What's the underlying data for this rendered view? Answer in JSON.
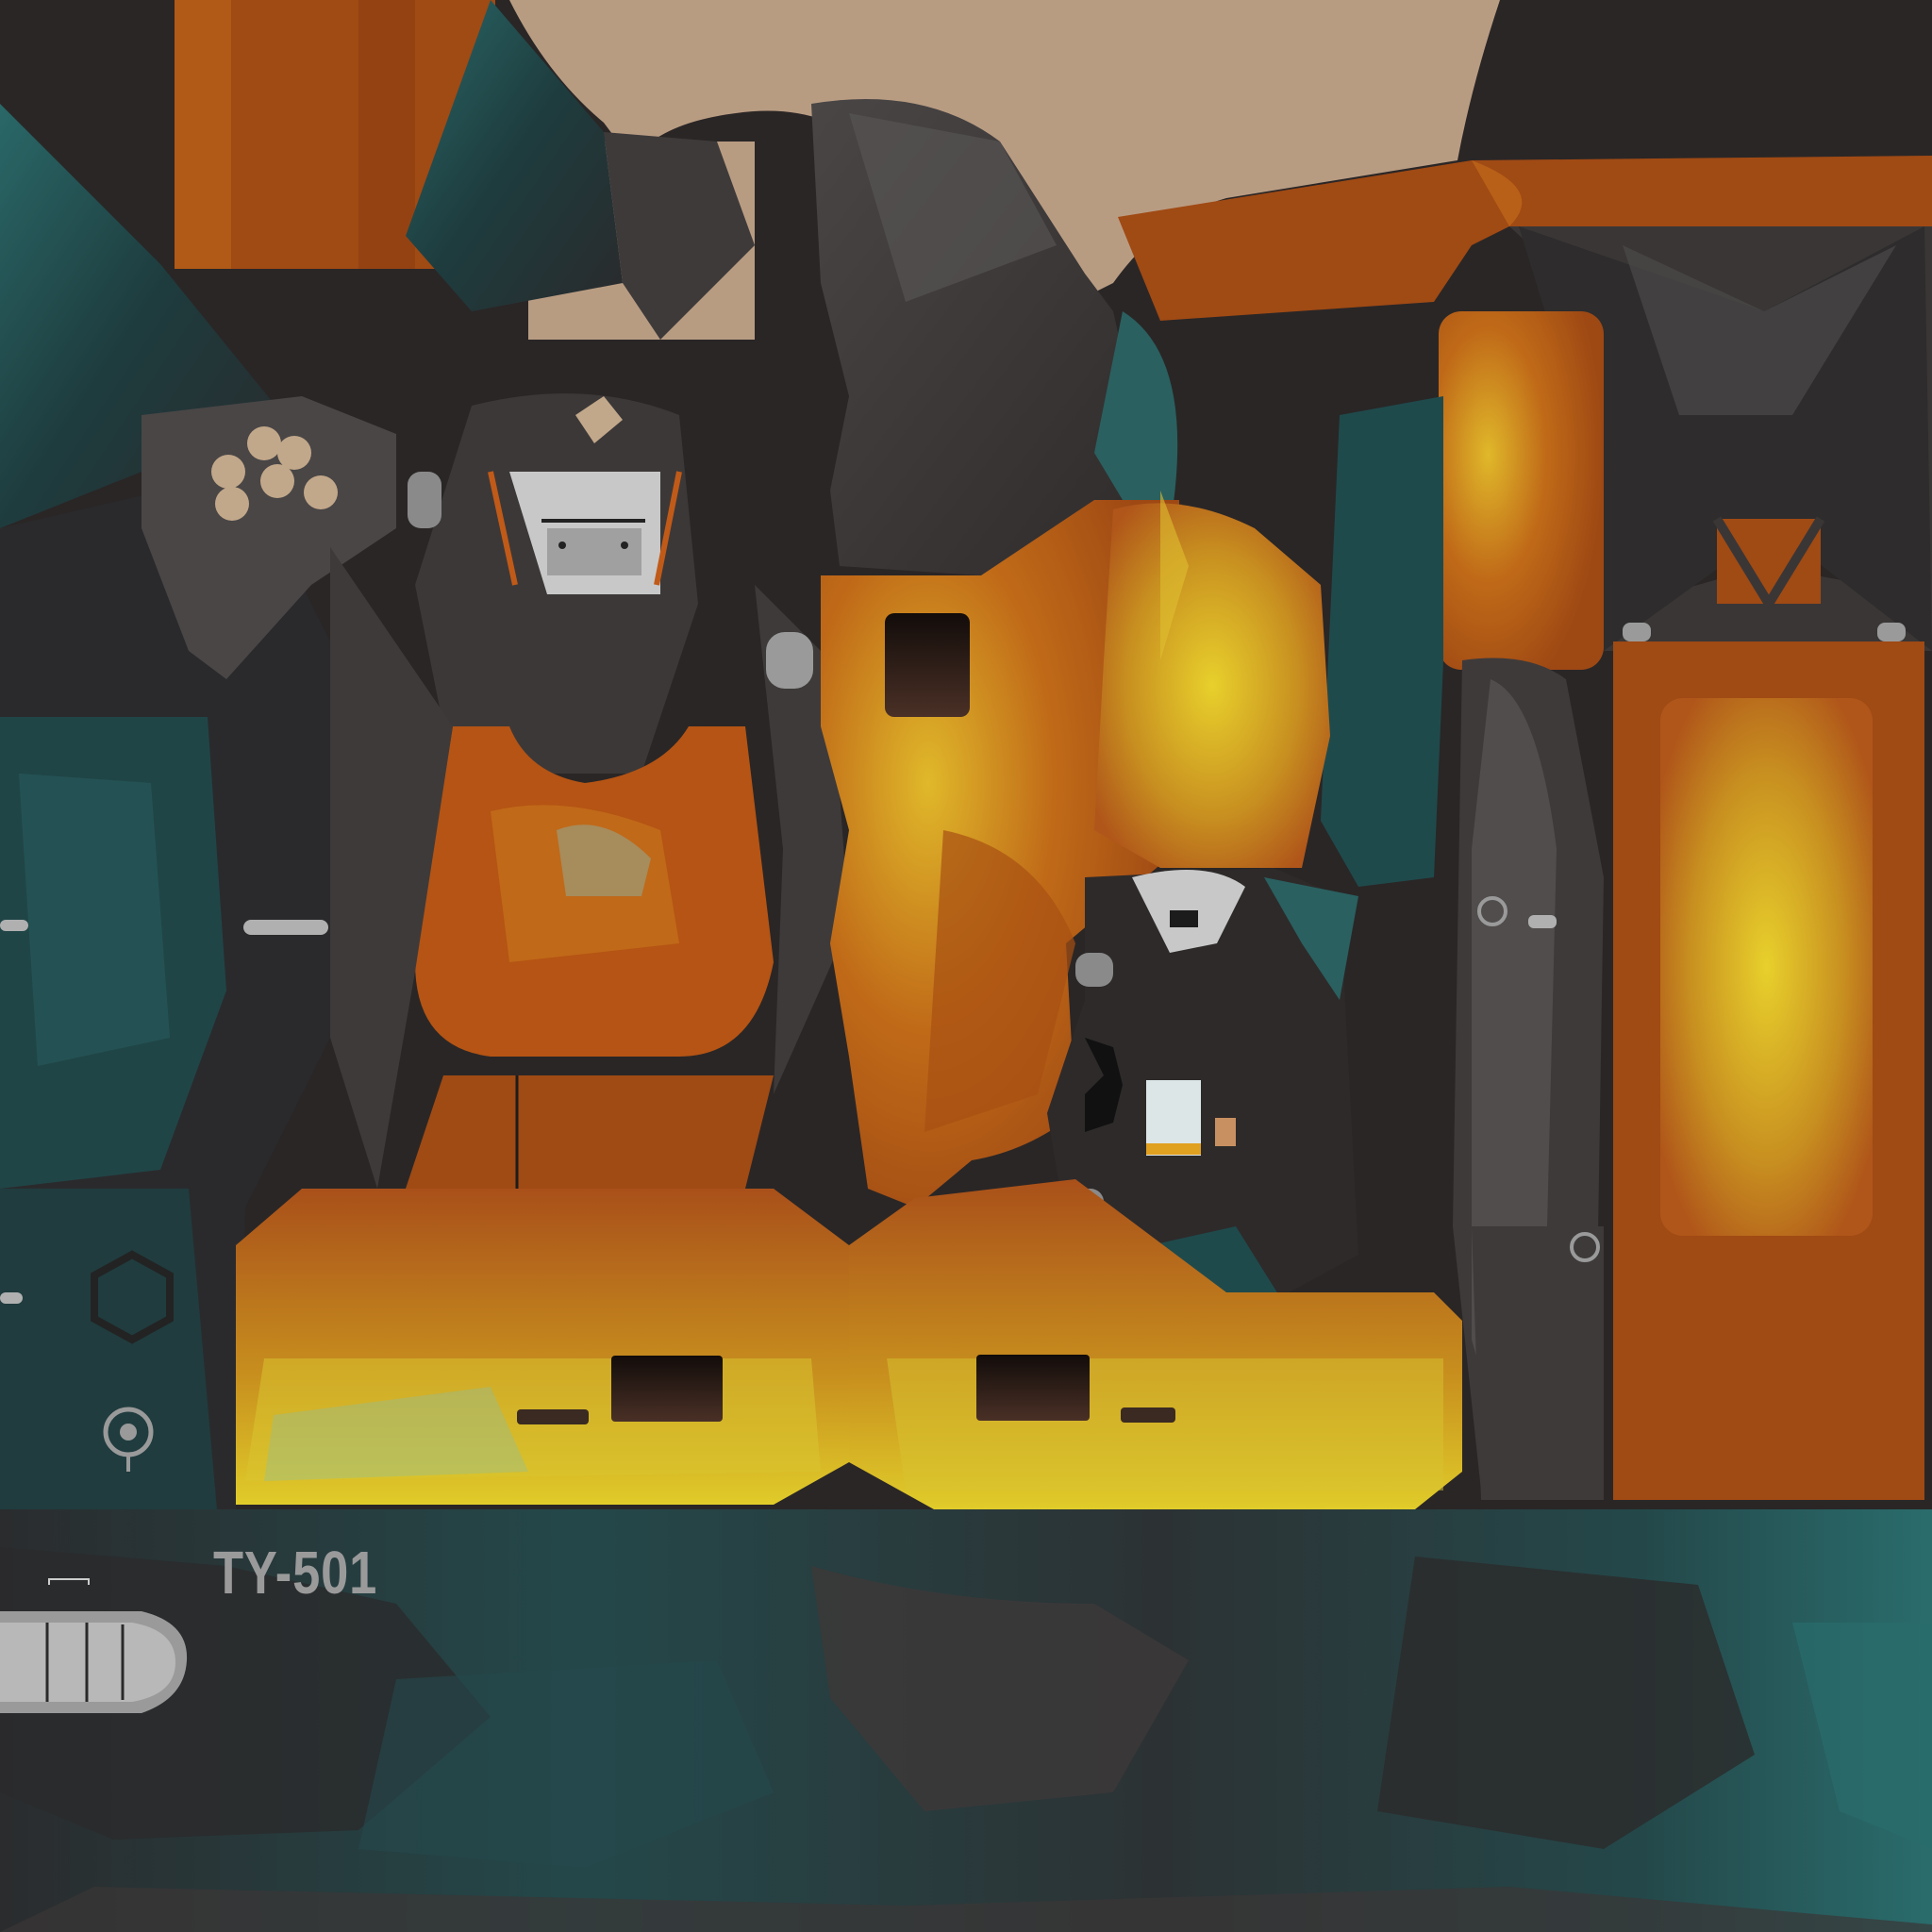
{
  "texture": {
    "code_label": "TY-501",
    "colors": {
      "background": "#2a2626",
      "tan": "#b89c82",
      "rust": "#a04a14",
      "burnt_orange": "#c05a18",
      "yellow": "#d8c028",
      "teal": "#1f4a4c",
      "teal_bright": "#2a6a6a",
      "charcoal": "#3a3636",
      "grey": "#8a8a8a",
      "light_grey": "#c8c8c8",
      "label_grey": "#9a9a9a"
    },
    "icons": [
      "hexagon-cluster-emblem",
      "target-ring-emblem",
      "hexagon-outline-emblem",
      "grille-panel"
    ]
  }
}
